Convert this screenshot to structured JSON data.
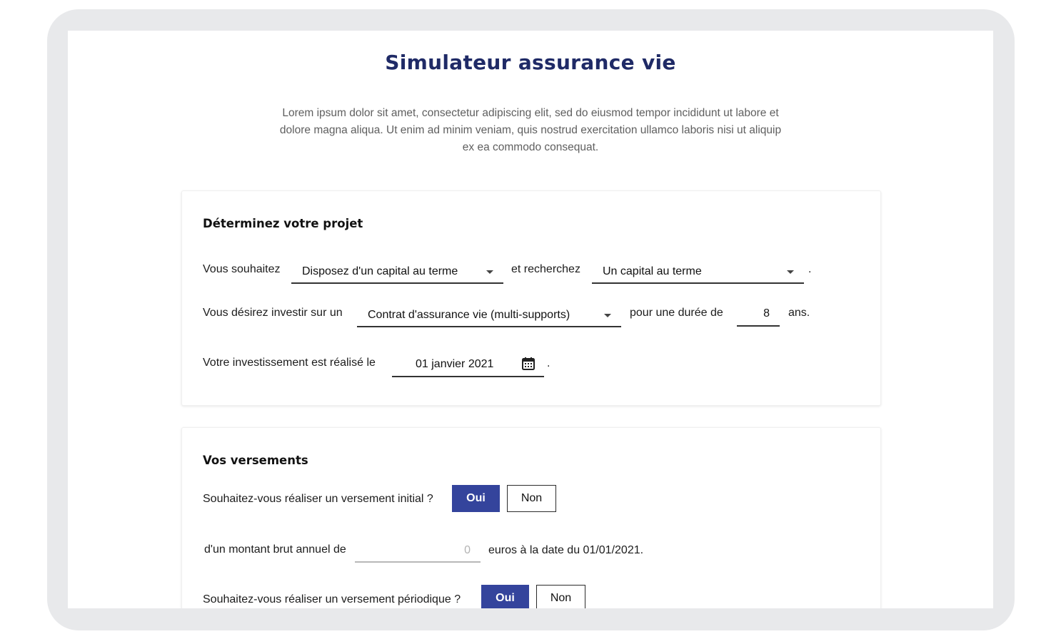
{
  "page": {
    "title": "Simulateur assurance vie",
    "intro": "Lorem ipsum dolor sit amet, consectetur adipiscing elit, sed do eiusmod tempor incididunt ut labore et dolore magna aliqua. Ut enim ad minim veniam, quis nostrud exercitation ullamco laboris nisi ut aliquip ex ea commodo consequat."
  },
  "projet": {
    "title": "Déterminez votre projet",
    "row1": {
      "label1": "Vous souhaitez",
      "select1": "Disposez d'un capital au terme",
      "label2": "et recherchez",
      "select2": "Un capital au terme",
      "end": "."
    },
    "row2": {
      "label1": "Vous désirez investir sur un",
      "select": "Contrat d'assurance vie (multi-supports)",
      "label2": "pour une durée de",
      "duration": "8",
      "unit": "ans."
    },
    "row3": {
      "label": "Votre investissement est réalisé le",
      "date": "01 janvier 2021",
      "end": "."
    }
  },
  "versements": {
    "title": "Vos versements",
    "initial": {
      "question": "Souhaitez-vous réaliser un versement initial ?",
      "yes": "Oui",
      "no": "Non"
    },
    "amount": {
      "label": "d'un montant brut annuel de",
      "value": "0",
      "suffix": "euros à la date du 01/01/2021."
    },
    "periodique": {
      "question": "Souhaitez-vous réaliser un versement périodique ?",
      "yes": "Oui",
      "no": "Non"
    }
  },
  "colors": {
    "title": "#1f2a66",
    "accent": "#34449c",
    "frame": "#e8e9eb"
  },
  "icons": {
    "caret": "chevron-down-icon",
    "calendar": "calendar-icon"
  }
}
